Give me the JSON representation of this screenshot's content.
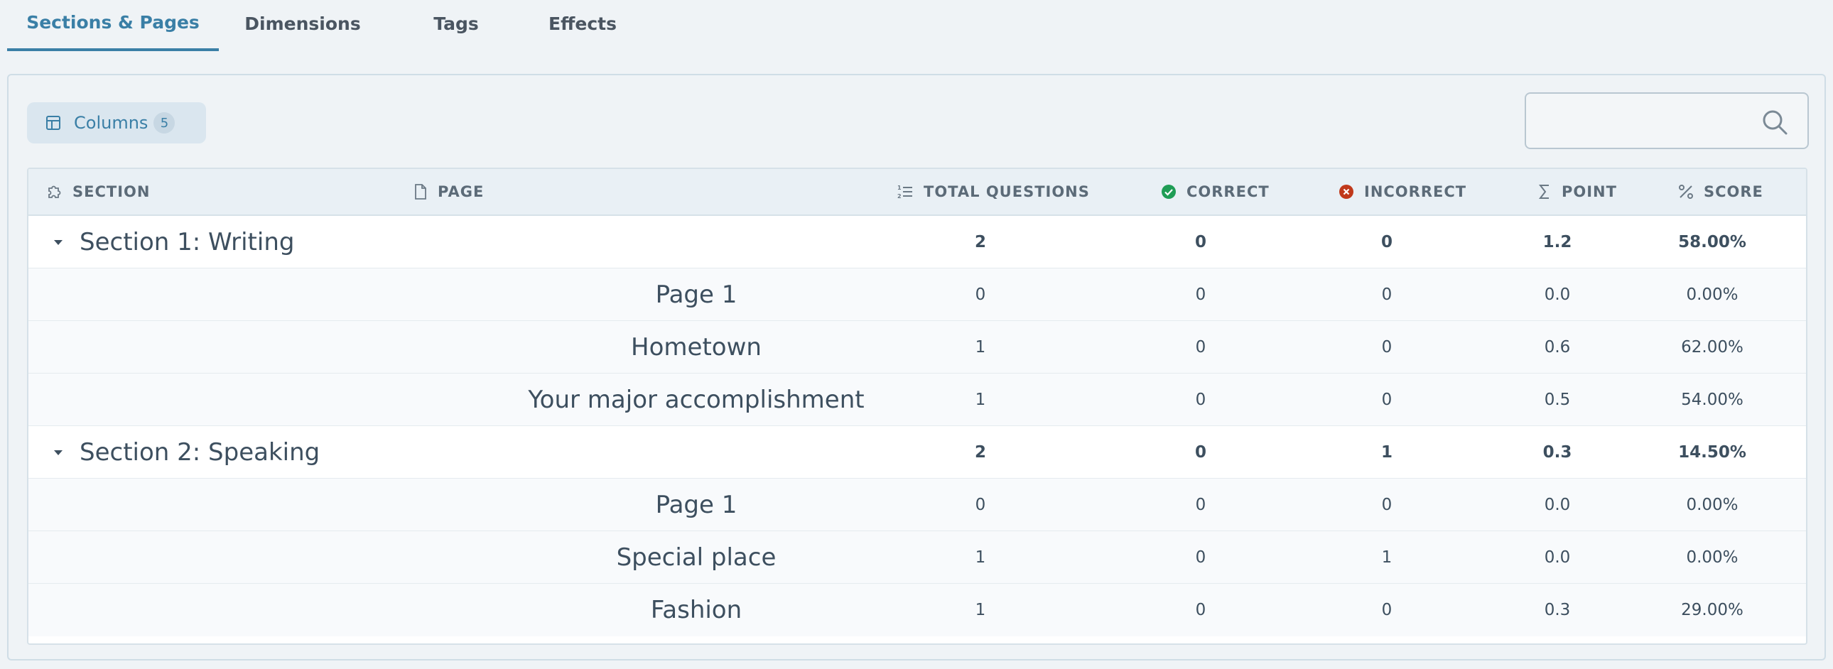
{
  "tabs": [
    {
      "label": "Sections & Pages",
      "active": true
    },
    {
      "label": "Dimensions",
      "active": false
    },
    {
      "label": "Tags",
      "active": false
    },
    {
      "label": "Effects",
      "active": false
    }
  ],
  "toolbar": {
    "columns_label": "Columns",
    "columns_count": "5",
    "search_placeholder": "",
    "search_value": ""
  },
  "table": {
    "headers": {
      "section": "SECTION",
      "page": "PAGE",
      "total_questions": "TOTAL QUESTIONS",
      "correct": "CORRECT",
      "incorrect": "INCORRECT",
      "point": "POINT",
      "score": "SCORE"
    },
    "sections": [
      {
        "title": "Section 1: Writing",
        "total": "2",
        "correct": "0",
        "incorrect": "0",
        "point": "1.2",
        "score": "58.00%",
        "pages": [
          {
            "name": "Page 1",
            "total": "0",
            "correct": "0",
            "incorrect": "0",
            "point": "0.0",
            "score": "0.00%"
          },
          {
            "name": "Hometown",
            "total": "1",
            "correct": "0",
            "incorrect": "0",
            "point": "0.6",
            "score": "62.00%"
          },
          {
            "name": "Your major accomplishment",
            "total": "1",
            "correct": "0",
            "incorrect": "0",
            "point": "0.5",
            "score": "54.00%"
          }
        ]
      },
      {
        "title": "Section 2: Speaking",
        "total": "2",
        "correct": "0",
        "incorrect": "1",
        "point": "0.3",
        "score": "14.50%",
        "pages": [
          {
            "name": "Page 1",
            "total": "0",
            "correct": "0",
            "incorrect": "0",
            "point": "0.0",
            "score": "0.00%"
          },
          {
            "name": "Special place",
            "total": "1",
            "correct": "0",
            "incorrect": "1",
            "point": "0.0",
            "score": "0.00%"
          },
          {
            "name": "Fashion",
            "total": "1",
            "correct": "0",
            "incorrect": "0",
            "point": "0.3",
            "score": "29.00%"
          }
        ]
      }
    ]
  },
  "colors": {
    "accent": "#3a7fa6",
    "correct_icon": "#1f9d55",
    "incorrect_icon": "#c0391b"
  },
  "icons": {
    "columns": "columns-layout-icon",
    "search": "search-icon",
    "section": "puzzle-icon",
    "page": "file-icon",
    "total_questions": "numbered-list-icon",
    "correct": "check-circle-icon",
    "incorrect": "x-circle-icon",
    "point": "sigma-icon",
    "score": "percent-icon",
    "expand": "caret-down-icon"
  }
}
